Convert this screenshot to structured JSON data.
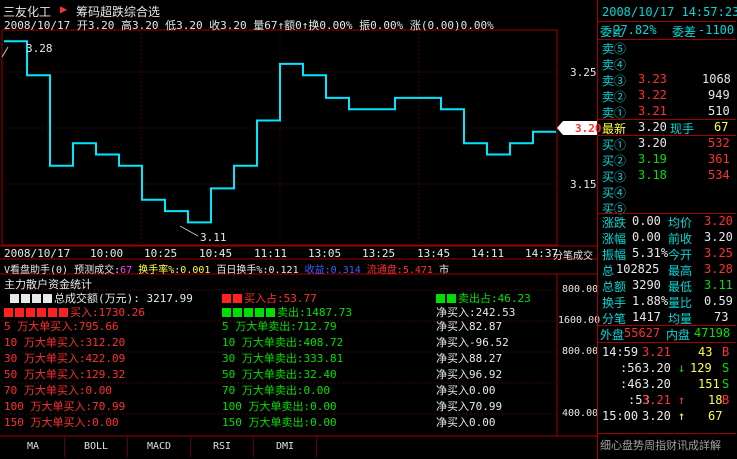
{
  "header": {
    "stock_name": "三友化工",
    "indicator_name": "筹码超跌综合选",
    "ohlc_line": "2008/10/17 开3.20 高3.20 低3.20 收3.20 量67↑额0↑换0.00% 振0.00% 涨(0.00)0.00%"
  },
  "price_axis": {
    "labels": [
      "3.25",
      "3.20",
      "3.15"
    ],
    "current_price": "3.20",
    "high_marker": "3.28",
    "low_marker": "3.11"
  },
  "time_axis": [
    "2008/10/17",
    "10:00",
    "10:25",
    "10:45",
    "11:11",
    "13:05",
    "13:25",
    "13:45",
    "14:11",
    "14:37"
  ],
  "time_axis_right": "分笔成交",
  "indicator_bar": {
    "assistant": "V看盘助手(0)",
    "forecast": "预测成交:",
    "forecast_value": "67",
    "turnover_label": "换手率%",
    "turnover_value": "0.001",
    "hundred_label": "百日换手%:",
    "hundred_value": "0.121",
    "collect_label": "收益:",
    "collect_value": "0.314",
    "flow_label": "流通盘:",
    "flow_value": "5.471",
    "market_label": "市"
  },
  "fund_stats": {
    "title": "主力散户资金统计",
    "total_label": "总成交额(万元)",
    "total_value": "3217.99",
    "buy_share_label": "买入占",
    "buy_share_value": "53.77",
    "sell_share_label": "卖出占",
    "sell_share_value": "46.23",
    "buy_label": "买入",
    "buy_value": "1730.26",
    "sell_label": "卖出",
    "sell_value": "1487.73",
    "net_label": "净买入",
    "net_value": "242.53",
    "rows": [
      {
        "buy": "5 万大单买入:795.66",
        "sell": "5 万大单卖出:712.79",
        "net": "净买入82.87"
      },
      {
        "buy": "10 万大单买入:312.20",
        "sell": "10 万大单卖出:408.72",
        "net": "净买入-96.52"
      },
      {
        "buy": "30 万大单买入:422.09",
        "sell": "30 万大单卖出:333.81",
        "net": "净买入88.27"
      },
      {
        "buy": "50 万大单买入:129.32",
        "sell": "50 万大单卖出:32.40",
        "net": "净买入96.92"
      },
      {
        "buy": "70 万大单买入:0.00",
        "sell": "70 万大单卖出:0.00",
        "net": "净买入0.00"
      },
      {
        "buy": "100 万大单买入:70.99",
        "sell": "100 万大单卖出:0.00",
        "net": "净买入70.99"
      },
      {
        "buy": "150 万大单买入:0.00",
        "sell": "150 万大单卖出:0.00",
        "net": "净买入0.00"
      }
    ],
    "axis_labels": [
      "800.00",
      "1600.00",
      "800.00",
      "400.00"
    ]
  },
  "bottom_tabs": [
    "MA",
    "BOLL",
    "MACD",
    "RSI",
    "DMI"
  ],
  "panel": {
    "datetime": "2008/10/17 14:57:23",
    "ratio_label": "委比",
    "ratio_value": "-27.82%",
    "diff_label": "委差",
    "diff_value": "-1100",
    "sell_levels": [
      {
        "label": "卖⑤",
        "price": "",
        "vol": ""
      },
      {
        "label": "卖④",
        "price": "",
        "vol": ""
      },
      {
        "label": "卖③",
        "price": "3.23",
        "vol": "1068"
      },
      {
        "label": "卖②",
        "price": "3.22",
        "vol": "949"
      },
      {
        "label": "卖①",
        "price": "3.21",
        "vol": "510"
      }
    ],
    "latest_label": "最新",
    "latest_price": "3.20",
    "current_hand_label": "现手",
    "current_hand": "67",
    "buy_levels": [
      {
        "label": "买①",
        "price": "3.20",
        "vol": "532"
      },
      {
        "label": "买②",
        "price": "3.19",
        "vol": "361"
      },
      {
        "label": "买③",
        "price": "3.18",
        "vol": "534"
      },
      {
        "label": "买④",
        "price": "",
        "vol": ""
      },
      {
        "label": "买⑤",
        "price": "",
        "vol": ""
      }
    ],
    "stats": [
      {
        "l": "涨跌",
        "lv": "0.00",
        "r": "均价",
        "rv": "3.20"
      },
      {
        "l": "涨幅",
        "lv": "0.00",
        "r": "前收",
        "rv": "3.20"
      },
      {
        "l": "振幅",
        "lv": "5.31%",
        "r": "今开",
        "rv": "3.25"
      },
      {
        "l": "总",
        "lv": "102825",
        "r": "最高",
        "rv": "3.28"
      },
      {
        "l": "总额",
        "lv": "3290",
        "r": "最低",
        "rv": "3.11"
      },
      {
        "l": "换手",
        "lv": "1.88%",
        "r": "量比",
        "rv": "0.59"
      },
      {
        "l": "分笔",
        "lv": "1417",
        "r": "均量",
        "rv": "73"
      }
    ],
    "outer_label": "外盘",
    "outer_value": "55627",
    "inner_label": "内盘",
    "inner_value": "47198",
    "ticks": [
      {
        "time": "14:59",
        "price": "3.21",
        "vol": "43",
        "flag": "B"
      },
      {
        "time": ":56",
        "price": "3.20",
        "vol": "129",
        "flag": "S"
      },
      {
        "time": ":46",
        "price": "3.20",
        "vol": "151",
        "flag": "S"
      },
      {
        "time": ":53",
        "price": "3.21",
        "vol": "18",
        "flag": "B"
      },
      {
        "time": "15:00",
        "price": "3.20",
        "vol": "67",
        "flag": ""
      }
    ],
    "footer": "细心盘势周指财讯成詳解"
  },
  "chart_data": {
    "type": "line",
    "x": [
      "09:30",
      "09:40",
      "09:50",
      "10:00",
      "10:10",
      "10:20",
      "10:30",
      "10:40",
      "10:50",
      "11:00",
      "11:10",
      "11:20",
      "13:00",
      "13:10",
      "13:20",
      "13:30",
      "13:40",
      "13:50",
      "14:00",
      "14:10",
      "14:20",
      "14:30",
      "14:40",
      "14:50",
      "15:00"
    ],
    "values": [
      3.28,
      3.25,
      3.17,
      3.19,
      3.18,
      3.17,
      3.14,
      3.13,
      3.12,
      3.15,
      3.17,
      3.21,
      3.26,
      3.25,
      3.23,
      3.22,
      3.22,
      3.23,
      3.23,
      3.22,
      3.19,
      3.18,
      3.19,
      3.2,
      3.2
    ],
    "ylim": [
      3.1,
      3.29
    ]
  },
  "colors": {
    "up": "#ff3030",
    "down": "#00e000",
    "line": "#00e8ff",
    "border": "#a00000"
  }
}
